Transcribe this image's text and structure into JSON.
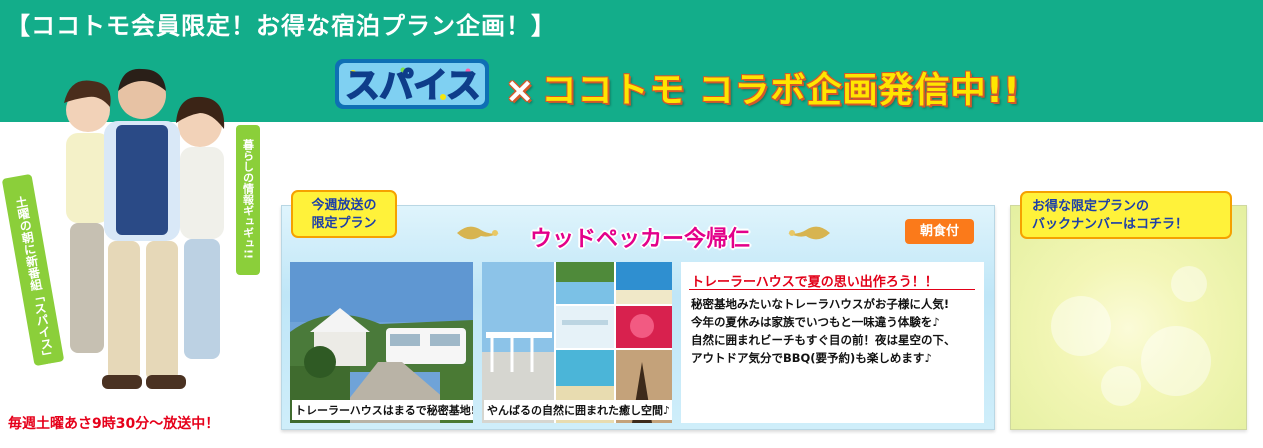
{
  "banner": {
    "title": "【ココトモ会員限定！お得な宿泊プラン企画！】",
    "logo_text": "スパイス",
    "collab_x": "×",
    "collab_text": "ココトモ コラボ企画発信中!!"
  },
  "left": {
    "tagline_right": "暮らしの情報ギュギュ!!",
    "tagline_left": "土曜の朝に新番組「スパイス」スタート!",
    "schedule": "毎週土曜あさ9時30分〜放送中！"
  },
  "weekly": {
    "label_line1": "今週放送の",
    "label_line2": "限定プラン",
    "hotel_name": "ウッドペッカー今帰仁",
    "badge": "朝食付",
    "photo1_caption": "トレーラーハウスはまるで秘密基地!",
    "photo2_caption": "やんばるの自然に囲まれた癒し空間♪",
    "desc_title": "トレーラーハウスで夏の思い出作ろう！！",
    "desc_lines": [
      "秘密基地みたいなトレーラハウスがお子様に人気!",
      "今年の夏休みは家族でいつもと一味違う体験を♪",
      "自然に囲まれビーチもすぐ目の前！夜は星空の下、",
      "アウトドア気分でBBQ(要予約)も楽しめます♪"
    ]
  },
  "backnumber": {
    "label_line1": "お得な限定プランの",
    "label_line2": "バックナンバーはコチラ！"
  },
  "colors": {
    "banner_green": "#13ad8a",
    "label_yellow": "#fff23a",
    "hotel_pink": "#e3008a",
    "badge_orange": "#fb7a1a",
    "alert_red": "#e20018"
  }
}
